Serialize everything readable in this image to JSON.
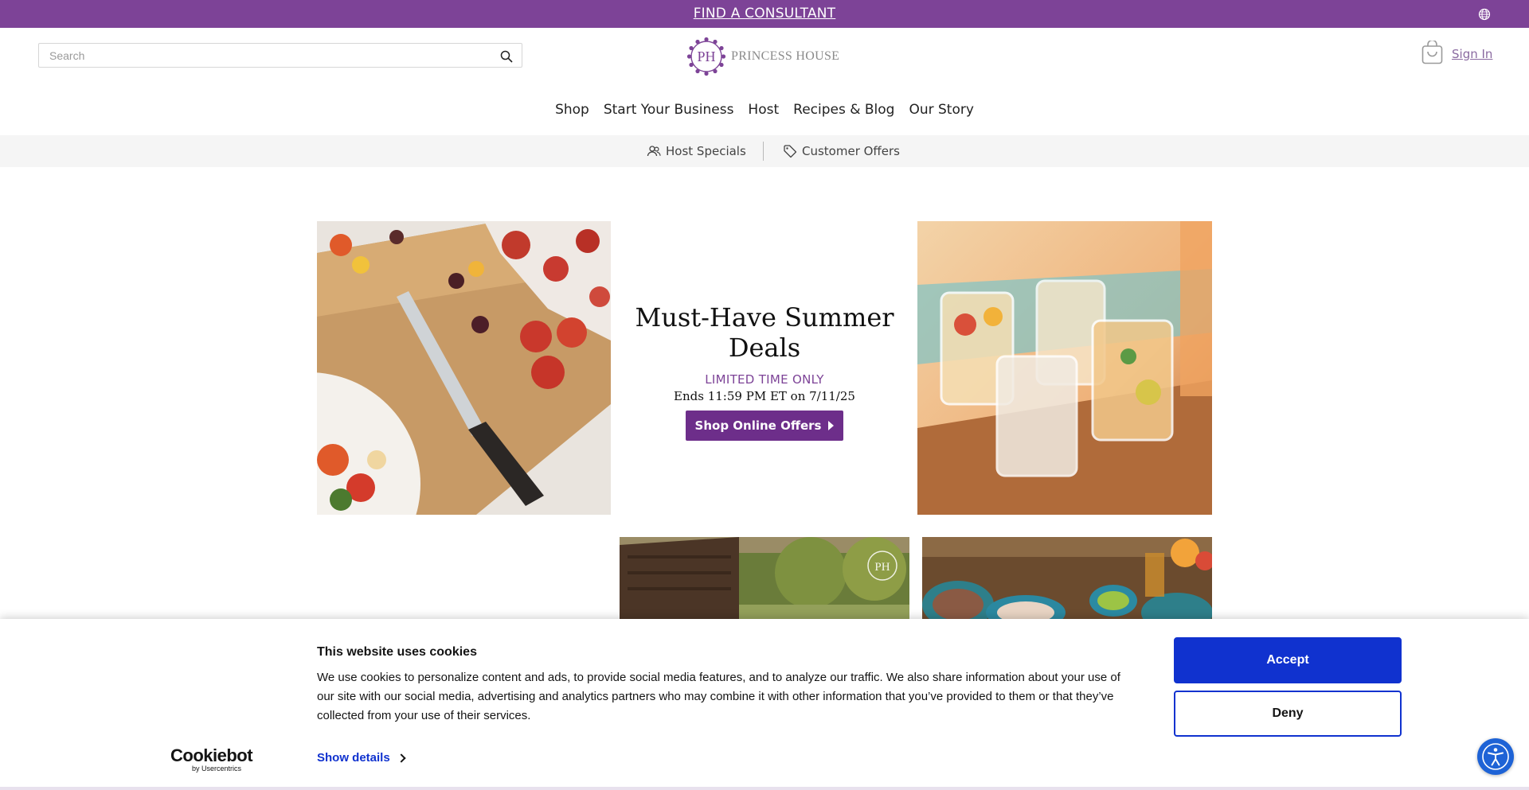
{
  "topbar": {
    "find_consultant": "FIND A CONSULTANT",
    "globe_icon": "globe-icon",
    "background": "#7d4397"
  },
  "header": {
    "search_placeholder": "Search",
    "search_icon": "search-icon",
    "logo_monogram": "PH",
    "logo_text": "PRINCESS HOUSE",
    "cart_icon": "cart-icon",
    "sign_in": "Sign In"
  },
  "nav": {
    "items": [
      {
        "label": "Shop"
      },
      {
        "label": "Start Your Business"
      },
      {
        "label": "Host"
      },
      {
        "label": "Recipes & Blog"
      },
      {
        "label": "Our Story"
      }
    ]
  },
  "subnav": {
    "host_specials": "Host Specials",
    "host_icon": "users-icon",
    "customer_offers": "Customer Offers",
    "offers_icon": "tag-icon"
  },
  "promo": {
    "title": "Must-Have Summer Deals",
    "limited": "LIMITED TIME ONLY",
    "ends": "Ends 11:59 PM ET on 7/11/25",
    "button": "Shop Online Offers",
    "accent": "#6d2e8a"
  },
  "images": {
    "knife": "knife-on-cutting-board-image",
    "glasses": "glasses-with-drinks-image",
    "patio": "patio-image",
    "table": "table-with-dishes-image",
    "patio_watermark": "PH"
  },
  "cookie": {
    "title": "This website uses cookies",
    "text": "We use cookies to personalize content and ads, to provide social media features,  and to analyze our traffic. We also share information about your use of our site with our social media, advertising and analytics partners who may combine it with other information that you’ve provided to them or that they’ve collected from your use of their services.",
    "brand": "Cookiebot",
    "brand_sub": "by Usercentrics",
    "show_details": "Show details",
    "accept": "Accept",
    "deny": "Deny",
    "accent": "#1032cf"
  },
  "accessibility": {
    "icon": "accessibility-icon",
    "color": "#1e63d6"
  }
}
